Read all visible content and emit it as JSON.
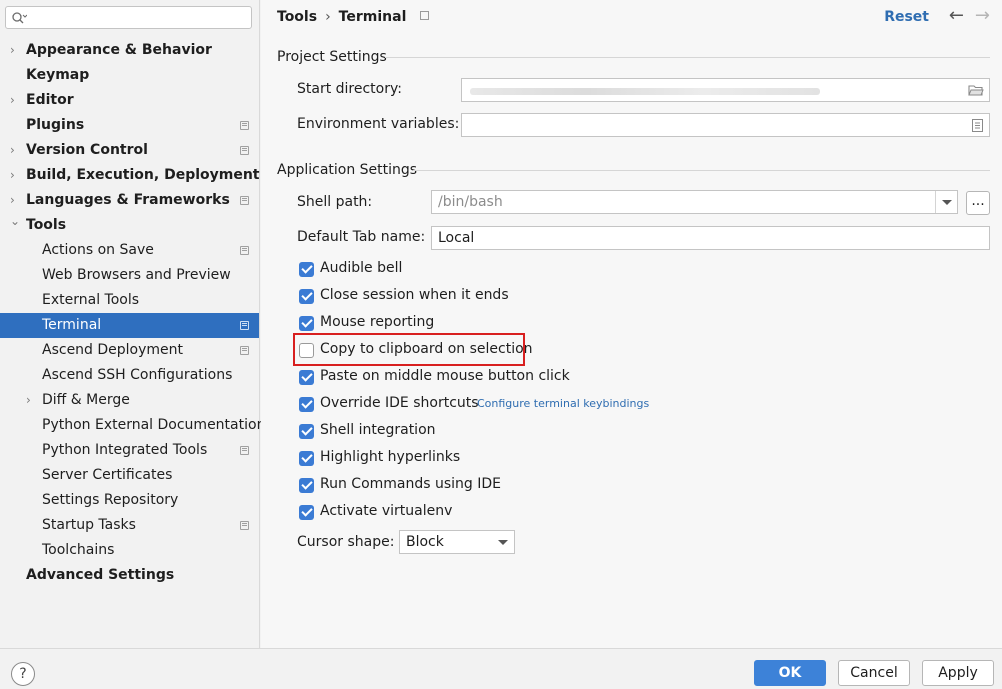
{
  "search": {
    "placeholder": ""
  },
  "sidebar": {
    "items": [
      {
        "label": "Appearance & Behavior",
        "level": 0,
        "expandable": true,
        "badge": false
      },
      {
        "label": "Keymap",
        "level": 0,
        "expandable": false,
        "badge": false
      },
      {
        "label": "Editor",
        "level": 0,
        "expandable": true,
        "badge": false
      },
      {
        "label": "Plugins",
        "level": 0,
        "expandable": false,
        "badge": true
      },
      {
        "label": "Version Control",
        "level": 0,
        "expandable": true,
        "badge": true
      },
      {
        "label": "Build, Execution, Deployment",
        "level": 0,
        "expandable": true,
        "badge": false
      },
      {
        "label": "Languages & Frameworks",
        "level": 0,
        "expandable": true,
        "badge": true
      },
      {
        "label": "Tools",
        "level": 0,
        "expandable": true,
        "expanded": true,
        "badge": false
      },
      {
        "label": "Actions on Save",
        "level": 1,
        "badge": true
      },
      {
        "label": "Web Browsers and Preview",
        "level": 1,
        "badge": false
      },
      {
        "label": "External Tools",
        "level": 1,
        "badge": false
      },
      {
        "label": "Terminal",
        "level": 1,
        "badge": true,
        "selected": true
      },
      {
        "label": "Ascend Deployment",
        "level": 1,
        "badge": true
      },
      {
        "label": "Ascend SSH Configurations",
        "level": 1,
        "badge": false
      },
      {
        "label": "Diff & Merge",
        "level": 1,
        "expandable": true,
        "badge": false
      },
      {
        "label": "Python External Documentation",
        "level": 1,
        "badge": false
      },
      {
        "label": "Python Integrated Tools",
        "level": 1,
        "badge": true
      },
      {
        "label": "Server Certificates",
        "level": 1,
        "badge": false
      },
      {
        "label": "Settings Repository",
        "level": 1,
        "badge": false
      },
      {
        "label": "Startup Tasks",
        "level": 1,
        "badge": true
      },
      {
        "label": "Toolchains",
        "level": 1,
        "badge": false
      },
      {
        "label": "Advanced Settings",
        "level": 0,
        "expandable": false,
        "badge": false
      }
    ]
  },
  "header": {
    "crumb_parent": "Tools",
    "crumb_separator": "›",
    "crumb_current": "Terminal",
    "reset_label": "Reset",
    "back_icon": "arrow-left-icon",
    "forward_icon": "arrow-right-icon"
  },
  "project_settings": {
    "title": "Project Settings",
    "start_directory_label": "Start directory:",
    "start_directory_value": "",
    "env_vars_label": "Environment variables:",
    "env_vars_value": ""
  },
  "app_settings": {
    "title": "Application Settings",
    "shell_path_label": "Shell path:",
    "shell_path_value": "/bin/bash",
    "browse_label": "...",
    "default_tab_label": "Default Tab name:",
    "default_tab_value": "Local",
    "checkboxes": [
      {
        "label": "Audible bell",
        "checked": true
      },
      {
        "label": "Close session when it ends",
        "checked": true
      },
      {
        "label": "Mouse reporting",
        "checked": true
      },
      {
        "label": "Copy to clipboard on selection",
        "checked": false
      },
      {
        "label": "Paste on middle mouse button click",
        "checked": true
      },
      {
        "label": "Override IDE shortcuts",
        "checked": true
      },
      {
        "label": "Shell integration",
        "checked": true
      },
      {
        "label": "Highlight hyperlinks",
        "checked": true
      },
      {
        "label": "Run Commands using IDE",
        "checked": true
      },
      {
        "label": "Activate virtualenv",
        "checked": true
      }
    ],
    "configure_link": "Configure terminal keybindings",
    "cursor_shape_label": "Cursor shape:",
    "cursor_shape_value": "Block"
  },
  "footer": {
    "help_label": "?",
    "ok_label": "OK",
    "cancel_label": "Cancel",
    "apply_label": "Apply"
  },
  "colors": {
    "accent": "#2f6fbf",
    "link": "#2f6db1",
    "highlight_box": "#d81f1f"
  }
}
